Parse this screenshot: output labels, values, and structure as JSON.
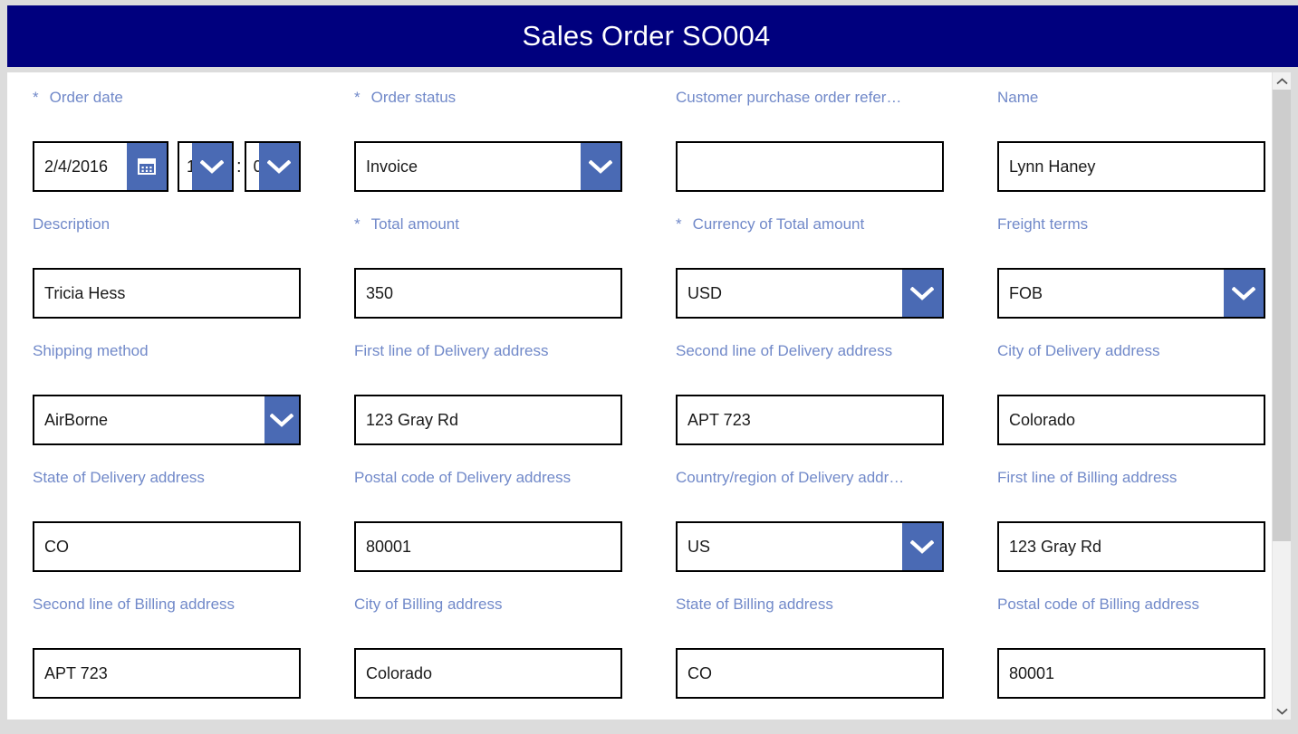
{
  "window": {
    "title": "Sales Order SO004"
  },
  "colors": {
    "titlebar_background": "#00007e",
    "titlebar_text": "#ffffff",
    "label_text": "#7189c9",
    "field_border": "#000000",
    "button_blue": "#4a6ab4",
    "page_background": "#dcdcdc",
    "surface_background": "#ffffff",
    "scrollbar_thumb": "#cdcdcd",
    "scrollbar_track": "#f1f1f1"
  },
  "icons": {
    "calendar": "calendar-icon",
    "chevron_down": "chevron-down-icon",
    "scroll_up": "scroll-up-arrow-icon",
    "scroll_down": "scroll-down-arrow-icon"
  },
  "form": {
    "required_marker": "*",
    "time_separator": ":",
    "fields": [
      {
        "name": "order-date",
        "label": "Order date",
        "required": true,
        "type": "datetime",
        "date_value": "2/4/2016",
        "hour_value": "1",
        "minute_value": "0"
      },
      {
        "name": "order-status",
        "label": "Order status",
        "required": true,
        "type": "select",
        "value": "Invoice"
      },
      {
        "name": "customer-purchase-order-reference",
        "label": "Customer purchase order refer…",
        "required": false,
        "type": "text",
        "value": ""
      },
      {
        "name": "name",
        "label": "Name",
        "required": false,
        "type": "text",
        "value": "Lynn Haney"
      },
      {
        "name": "description",
        "label": "Description",
        "required": false,
        "type": "text",
        "value": "Tricia Hess"
      },
      {
        "name": "total-amount",
        "label": "Total amount",
        "required": true,
        "type": "text",
        "value": "350"
      },
      {
        "name": "currency-of-total-amount",
        "label": "Currency of Total amount",
        "required": true,
        "type": "select",
        "value": "USD"
      },
      {
        "name": "freight-terms",
        "label": "Freight terms",
        "required": false,
        "type": "select",
        "value": "FOB"
      },
      {
        "name": "shipping-method",
        "label": "Shipping method",
        "required": false,
        "type": "select",
        "value": "AirBorne"
      },
      {
        "name": "first-line-of-delivery-address",
        "label": "First line of Delivery address",
        "required": false,
        "type": "text",
        "value": "123 Gray Rd"
      },
      {
        "name": "second-line-of-delivery-address",
        "label": "Second line of Delivery address",
        "required": false,
        "type": "text",
        "value": "APT 723"
      },
      {
        "name": "city-of-delivery-address",
        "label": "City of Delivery address",
        "required": false,
        "type": "text",
        "value": "Colorado"
      },
      {
        "name": "state-of-delivery-address",
        "label": "State of Delivery address",
        "required": false,
        "type": "text",
        "value": "CO"
      },
      {
        "name": "postal-code-of-delivery-address",
        "label": "Postal code of Delivery address",
        "required": false,
        "type": "text",
        "value": "80001"
      },
      {
        "name": "country-region-of-delivery-address",
        "label": "Country/region of Delivery addr…",
        "required": false,
        "type": "select",
        "value": "US"
      },
      {
        "name": "first-line-of-billing-address",
        "label": "First line of Billing address",
        "required": false,
        "type": "text",
        "value": "123 Gray Rd"
      },
      {
        "name": "second-line-of-billing-address",
        "label": "Second line of Billing address",
        "required": false,
        "type": "text",
        "value": "APT 723"
      },
      {
        "name": "city-of-billing-address",
        "label": "City of Billing address",
        "required": false,
        "type": "text",
        "value": "Colorado"
      },
      {
        "name": "state-of-billing-address",
        "label": "State of Billing address",
        "required": false,
        "type": "text",
        "value": "CO"
      },
      {
        "name": "postal-code-of-billing-address",
        "label": "Postal code of Billing address",
        "required": false,
        "type": "text",
        "value": "80001"
      }
    ]
  }
}
